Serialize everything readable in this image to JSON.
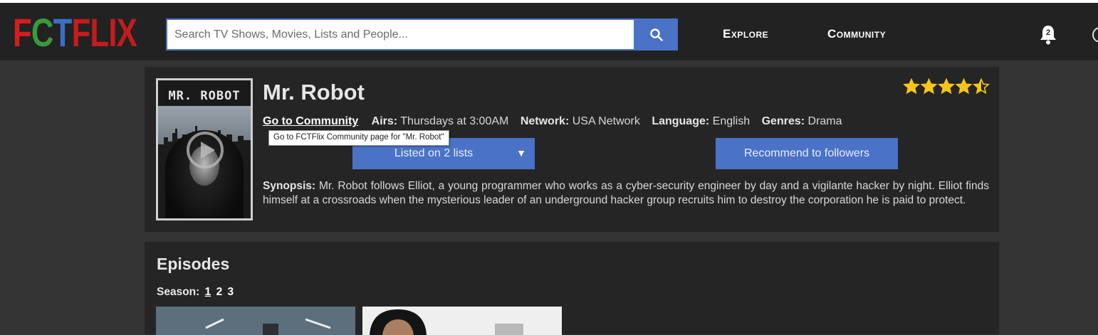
{
  "logo": {
    "letters": [
      "F",
      "C",
      "T",
      "F",
      "L",
      "I",
      "X"
    ],
    "colors": [
      "#d61d1d",
      "#3a9a3a",
      "#3a6fc4",
      "#c41c1c",
      "#c41c1c",
      "#c41c1c",
      "#c41c1c"
    ]
  },
  "search": {
    "placeholder": "Search TV Shows, Movies, Lists and People..."
  },
  "nav": {
    "explore": "Explore",
    "community": "Community",
    "notifications_count": "2"
  },
  "show": {
    "poster_title": "MR. ROBOT",
    "title": "Mr. Robot",
    "rating": 4.5,
    "community_link": "Go to Community",
    "tooltip": "Go to FCTFlix Community page for \"Mr. Robot\"",
    "airs_label": "Airs:",
    "airs_value": "Thursdays at 3:00AM",
    "network_label": "Network:",
    "network_value": "USA Network",
    "language_label": "Language:",
    "language_value": "English",
    "genres_label": "Genres:",
    "genres_value": "Drama",
    "lists_button": "Listed on 2 lists",
    "recommend_button": "Recommend to followers",
    "synopsis_label": "Synopsis:",
    "synopsis_text": "Mr. Robot follows Elliot, a young programmer who works as a cyber-security engineer by day and a vigilante hacker by night. Elliot finds himself at a crossroads when the mysterious leader of an underground hacker group recruits him to destroy the corporation he is paid to protect."
  },
  "episodes": {
    "heading": "Episodes",
    "season_label": "Season:",
    "seasons": [
      "1",
      "2",
      "3"
    ],
    "active_season": "1"
  },
  "colors": {
    "accent": "#4a72c7",
    "star": "#f5c518",
    "background": "#333333",
    "panel": "#252525",
    "navbar": "#222222"
  }
}
